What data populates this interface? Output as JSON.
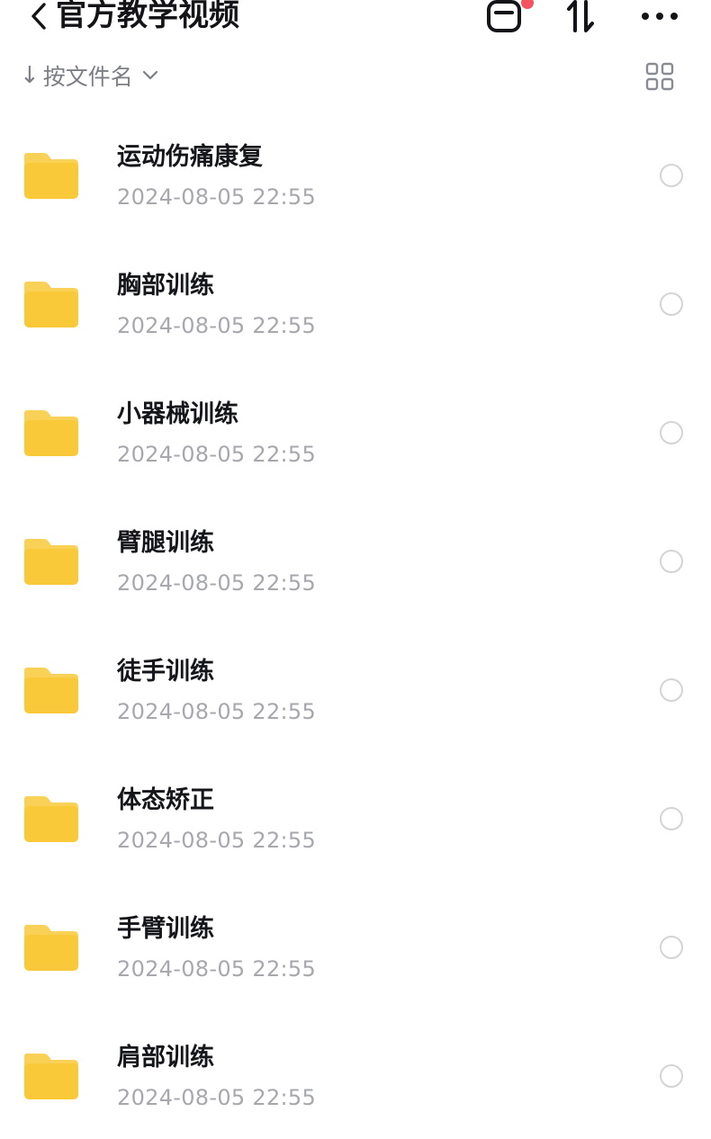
{
  "header": {
    "title": "官方教学视频",
    "back_icon": "chevron-left-icon",
    "actions": [
      "transfer-icon",
      "sort-icon",
      "more-icon"
    ],
    "notification_dot_color": "#f5535d"
  },
  "sortbar": {
    "arrow": "↓",
    "label": "按文件名",
    "view_toggle_icon": "grid-view-icon"
  },
  "folder_color": "#f9c93a",
  "files": [
    {
      "name": "运动伤痛康复",
      "date": "2024-08-05 22:55"
    },
    {
      "name": "胸部训练",
      "date": "2024-08-05 22:55"
    },
    {
      "name": "小器械训练",
      "date": "2024-08-05 22:55"
    },
    {
      "name": "臂腿训练",
      "date": "2024-08-05 22:55"
    },
    {
      "name": "徒手训练",
      "date": "2024-08-05 22:55"
    },
    {
      "name": "体态矫正",
      "date": "2024-08-05 22:55"
    },
    {
      "name": "手臂训练",
      "date": "2024-08-05 22:55"
    },
    {
      "name": "肩部训练",
      "date": "2024-08-05 22:55"
    }
  ]
}
